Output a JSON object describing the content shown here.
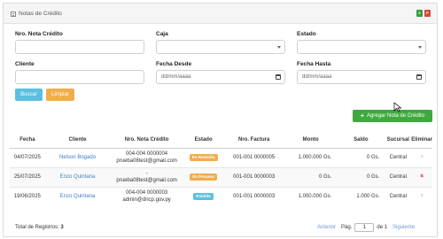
{
  "panel": {
    "title": "Notas de Crédito"
  },
  "icons": {
    "excel": "excel-icon",
    "pdf": "pdf-icon",
    "colors": {
      "excel": "#3c9a3c",
      "pdf": "#d64b3a"
    }
  },
  "filters": {
    "nro_nota_label": "Nro. Nota Crédito",
    "nro_nota_value": "",
    "caja_label": "Caja",
    "caja_value": "",
    "estado_label": "Estado",
    "estado_value": "",
    "cliente_label": "Cliente",
    "cliente_value": "",
    "fecha_desde_label": "Fecha Desde",
    "fecha_desde_placeholder": "dd/mm/aaaa",
    "fecha_hasta_label": "Fecha Hasta",
    "fecha_hasta_placeholder": "dd/mm/aaaa"
  },
  "buttons": {
    "buscar": "Buscar",
    "limpiar": "Limpiar",
    "agregar": "Agregar Nota de Crédito",
    "colors": {
      "buscar": "#5bc0de",
      "limpiar": "#f0ad4e",
      "agregar": "#3fa93f"
    }
  },
  "table": {
    "headers": [
      "Fecha",
      "Cliente",
      "Nro. Nota Crédito",
      "Estado",
      "Nro. Factura",
      "Monto",
      "Saldo",
      "Sucursal",
      "Eliminar"
    ],
    "rows": [
      {
        "fecha": "04/07/2025",
        "cliente": "Nelson Bogado",
        "nro_nota": "004-004 0000004",
        "email": "prueba08test@gmail.com",
        "estado": "En Revisión",
        "estado_color": "#f0ad4e",
        "factura": "001-001 0000005",
        "monto": "1.000.000 Gs.",
        "saldo": "0 Gs.",
        "sucursal": "Central",
        "eliminar": "×",
        "eliminar_enabled": false
      },
      {
        "fecha": "25/07/2025",
        "cliente": "Enzo Quintana",
        "nro_nota": "-",
        "email": "prueba08test@gmail.com",
        "estado": "En Proceso",
        "estado_color": "#f0ad4e",
        "factura": "001-001 0000003",
        "monto": "0 Gs.",
        "saldo": "0 Gs.",
        "sucursal": "Central",
        "eliminar": "×",
        "eliminar_enabled": true
      },
      {
        "fecha": "19/06/2025",
        "cliente": "Enzo Quintana",
        "nro_nota": "004-004 0000003",
        "email": "admin@dncp.gov.py",
        "estado": "Emitido",
        "estado_color": "#5bc0de",
        "factura": "001-001 0000003",
        "monto": "1.000.000 Gs.",
        "saldo": "1.000 Gs.",
        "sucursal": "Central",
        "eliminar": "×",
        "eliminar_enabled": false
      }
    ]
  },
  "footer": {
    "total_label": "Total de Registros:",
    "total_value": "3",
    "anterior": "Anterior",
    "pag_label": "Pág.",
    "page": "1",
    "of_label": "de 1",
    "siguiente": "Siguiente"
  }
}
